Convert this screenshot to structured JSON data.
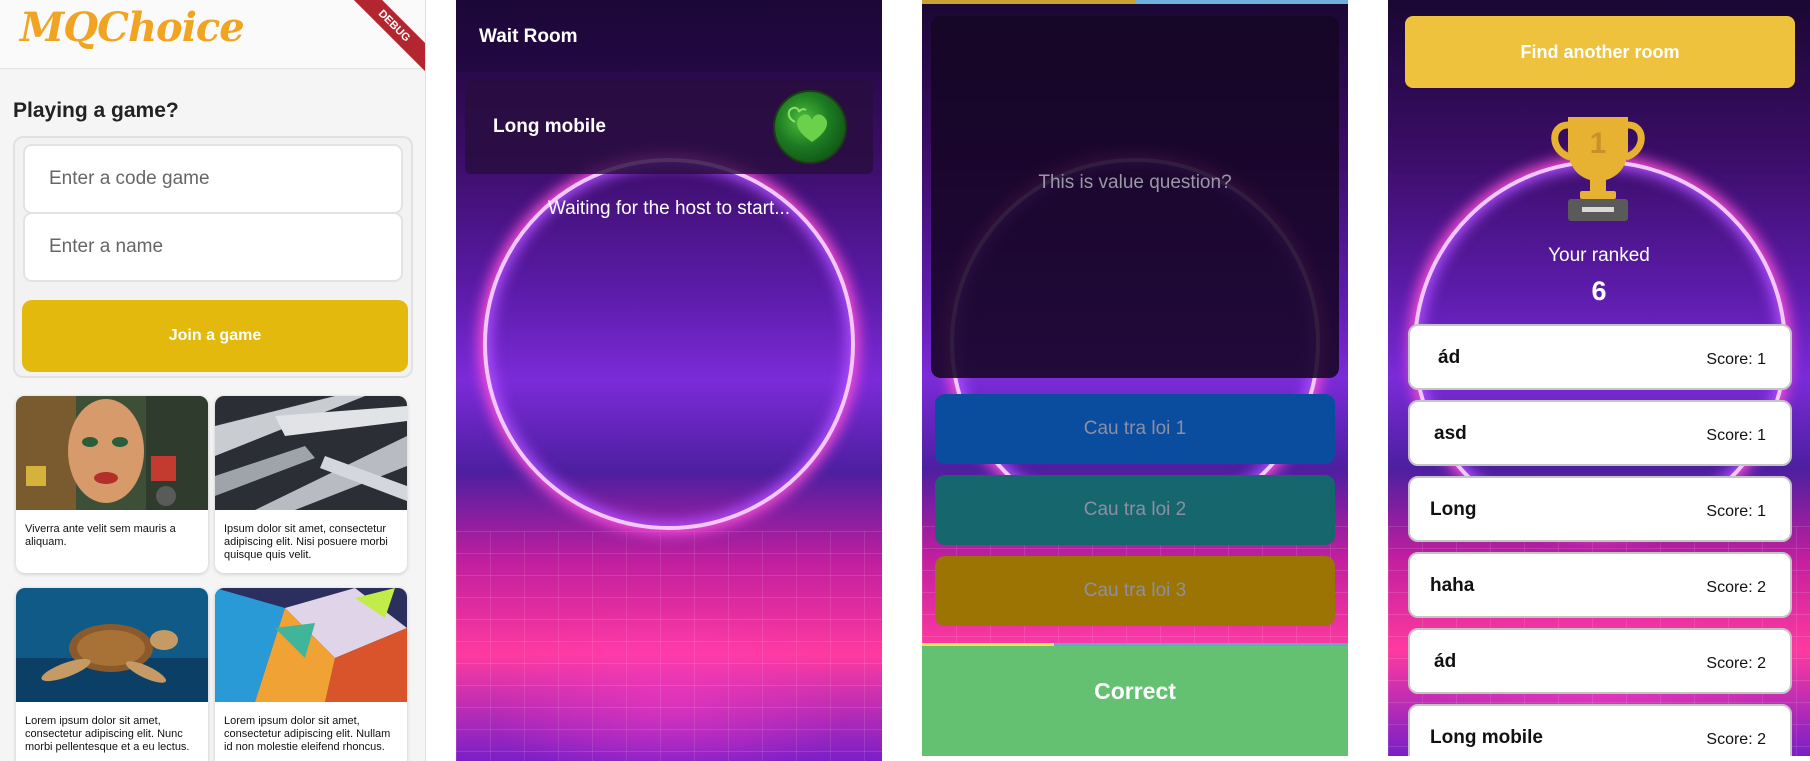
{
  "screen1": {
    "logo": "MQChoice",
    "debug_banner": "DEBUG",
    "heading": "Playing a game?",
    "code_field": {
      "placeholder": "Enter a code game",
      "value": ""
    },
    "name_field": {
      "placeholder": "Enter a name",
      "value": ""
    },
    "join_button": "Join a game",
    "cards": [
      {
        "text": "Viverra ante velit sem mauris a aliquam."
      },
      {
        "text": "Ipsum dolor sit amet, consectetur adipiscing elit. Nisi posuere morbi quisque quis velit."
      },
      {
        "text": "Lorem ipsum dolor sit amet, consectetur adipiscing elit. Nunc morbi pellentesque et a eu lectus."
      },
      {
        "text": "Lorem ipsum dolor sit amet, consectetur adipiscing elit. Nullam id non molestie eleifend rhoncus."
      }
    ]
  },
  "screen2": {
    "title": "Wait Room",
    "player_name": "Long mobile",
    "status": "Waiting for the host to start..."
  },
  "screen3": {
    "question": "This is value question?",
    "answers": [
      "Cau tra loi 1",
      "Cau tra loi 2",
      "Cau tra loi 3"
    ],
    "answer_colors": [
      "#0a4c9e",
      "#15676d",
      "#9b7403"
    ],
    "result": "Correct",
    "result_color": "#63c171",
    "timer_fraction": 0.31,
    "top_progress_fraction": 0.5
  },
  "screen4": {
    "find_button": "Find another room",
    "trophy_number": "1",
    "rank_label": "Your ranked",
    "rank_value": "6",
    "players": [
      {
        "name": "ád",
        "score": "Score: 1"
      },
      {
        "name": "asd",
        "score": "Score: 1"
      },
      {
        "name": "Long",
        "score": "Score: 1"
      },
      {
        "name": "haha",
        "score": "Score: 2"
      },
      {
        "name": "ád",
        "score": "Score: 2"
      },
      {
        "name": "Long mobile",
        "score": "Score: 2"
      }
    ]
  },
  "colors": {
    "accent_yellow": "#e2b90c",
    "logo_orange": "#f0a422",
    "find_button_yellow": "#eec23c"
  }
}
